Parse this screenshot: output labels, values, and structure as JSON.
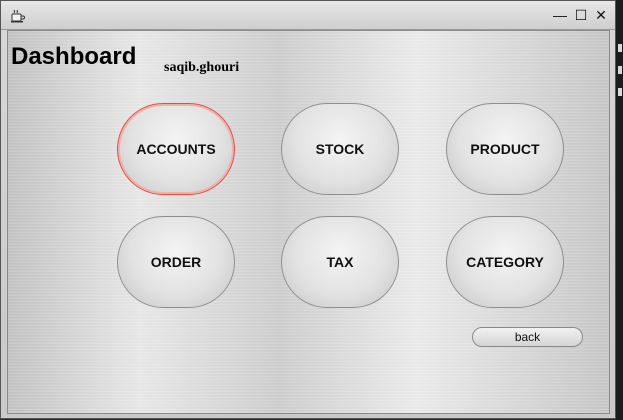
{
  "window": {
    "minimize_glyph": "—",
    "maximize_glyph": "☐",
    "close_glyph": "✕"
  },
  "dashboard": {
    "title": "Dashboard",
    "user": "saqib.ghouri",
    "buttons": {
      "accounts": "ACCOUNTS",
      "stock": "STOCK",
      "product": "PRODUCT",
      "order": "ORDER",
      "tax": "TAX",
      "category": "CATEGORY"
    },
    "focused_button": "ACCOUNTS",
    "back_label": "back"
  },
  "icons": {
    "app": "java-cup-icon",
    "minimize": "minimize-icon",
    "maximize": "maximize-icon",
    "close": "close-icon"
  }
}
